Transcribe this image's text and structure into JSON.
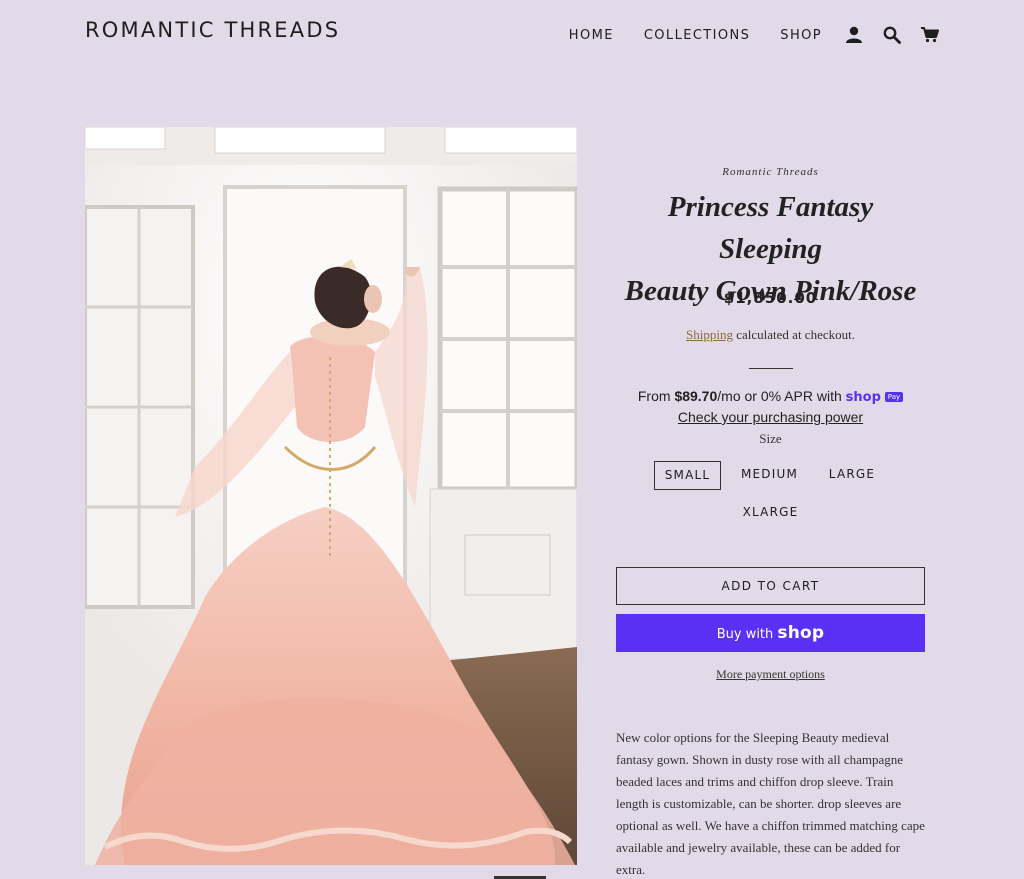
{
  "brand": "ROMANTIC THREADS",
  "nav": {
    "items": [
      "HOME",
      "COLLECTIONS",
      "SHOP"
    ],
    "icons": [
      "account-icon",
      "search-icon",
      "cart-icon"
    ]
  },
  "product": {
    "vendor": "Romantic Threads",
    "title_line1": "Princess Fantasy Sleeping",
    "title_line2": "Beauty Gown Pink/Rose",
    "price": "$1,850.00",
    "shipping_link": "Shipping",
    "shipping_rest": " calculated at checkout.",
    "installments": {
      "prefix": "From ",
      "amount": "$89.70",
      "suffix": "/mo or 0% APR with ",
      "brand": "shop",
      "badge": "Pay",
      "link": "Check your purchasing power"
    },
    "size_label": "Size",
    "sizes": [
      "SMALL",
      "MEDIUM",
      "LARGE",
      "XLARGE"
    ],
    "selected_size": "SMALL",
    "add_to_cart": "ADD TO CART",
    "buy_with": "Buy with",
    "buy_brand": "shop",
    "more_payment": "More payment options",
    "description": "New color options for the Sleeping Beauty medieval fantasy gown. Shown in dusty rose with all champagne beaded laces and trims and chiffon drop sleeve. Train length is customizable, can be shorter. drop sleeves are optional as well. We have a chiffon trimmed matching cape available and jewelry available, these can be added for extra."
  },
  "colors": {
    "background": "#e2d9e9",
    "shop_pay": "#5a31f4",
    "link_accent": "#8a6a3a"
  }
}
